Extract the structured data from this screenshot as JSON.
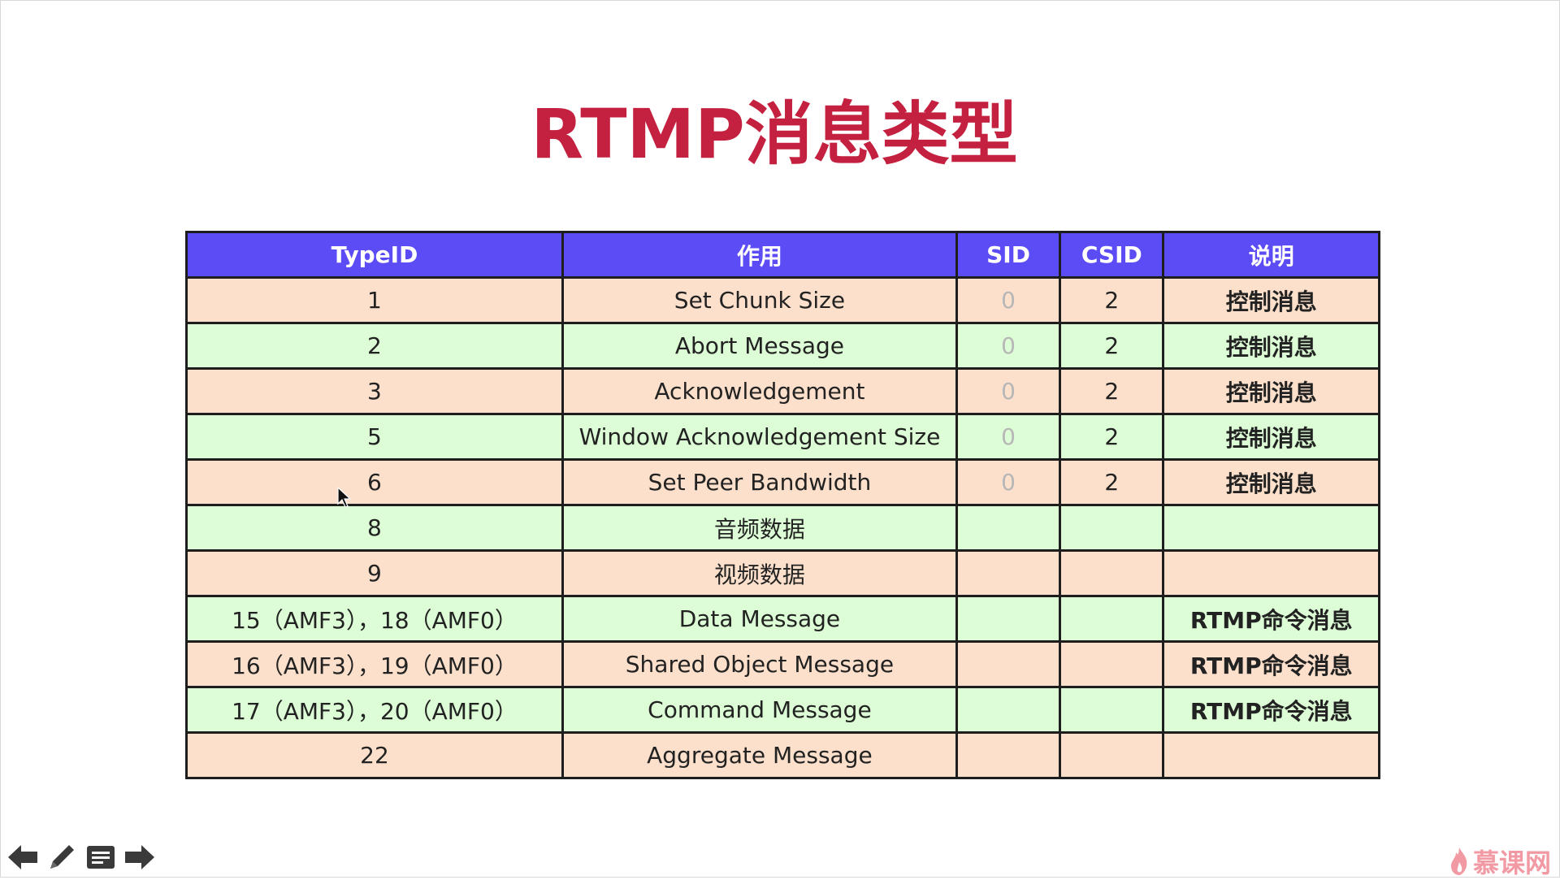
{
  "slide": {
    "title": "RTMP消息类型"
  },
  "table": {
    "headers": [
      "TypeID",
      "作用",
      "SID",
      "CSID",
      "说明"
    ],
    "rows": [
      {
        "type_id": "1",
        "function": "Set Chunk Size",
        "sid": "0",
        "csid": "2",
        "note": "控制消息"
      },
      {
        "type_id": "2",
        "function": "Abort Message",
        "sid": "0",
        "csid": "2",
        "note": "控制消息"
      },
      {
        "type_id": "3",
        "function": "Acknowledgement",
        "sid": "0",
        "csid": "2",
        "note": "控制消息"
      },
      {
        "type_id": "5",
        "function": "Window Acknowledgement Size",
        "sid": "0",
        "csid": "2",
        "note": "控制消息"
      },
      {
        "type_id": "6",
        "function": "Set Peer Bandwidth",
        "sid": "0",
        "csid": "2",
        "note": "控制消息"
      },
      {
        "type_id": "8",
        "function": "音频数据",
        "sid": "",
        "csid": "",
        "note": ""
      },
      {
        "type_id": "9",
        "function": "视频数据",
        "sid": "",
        "csid": "",
        "note": ""
      },
      {
        "type_id": "15（AMF3），18（AMF0）",
        "function": "Data Message",
        "sid": "",
        "csid": "",
        "note": "RTMP命令消息"
      },
      {
        "type_id": "16（AMF3），19（AMF0）",
        "function": "Shared Object Message",
        "sid": "",
        "csid": "",
        "note": "RTMP命令消息"
      },
      {
        "type_id": "17（AMF3），20（AMF0）",
        "function": "Command Message",
        "sid": "",
        "csid": "",
        "note": "RTMP命令消息"
      },
      {
        "type_id": "22",
        "function": "Aggregate Message",
        "sid": "",
        "csid": "",
        "note": ""
      }
    ]
  },
  "toolbar": {
    "icons": [
      "arrow-left-icon",
      "pencil-icon",
      "menu-icon",
      "arrow-right-icon"
    ]
  },
  "watermark": {
    "text": "慕课网"
  },
  "colors": {
    "title": "#c4203f",
    "header_bg": "#5b4cf5",
    "row_peach": "#fce0cb",
    "row_green": "#dcfdd5",
    "sid_zero": "#b7b7b7"
  }
}
